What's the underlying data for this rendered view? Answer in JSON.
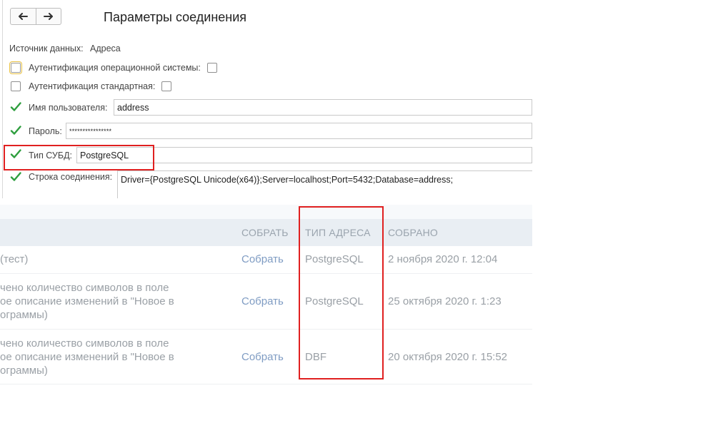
{
  "dialog": {
    "title": "Параметры соединения",
    "data_source": {
      "label": "Источник данных:",
      "value": "Адреса"
    },
    "os_auth": {
      "label": "Аутентификация операционной системы:",
      "enabled": false,
      "value": false
    },
    "std_auth": {
      "label": "Аутентификация стандартная:",
      "enabled": false,
      "value": false
    },
    "username": {
      "label": "Имя пользователя:",
      "enabled": true,
      "value": "address"
    },
    "password": {
      "label": "Пароль:",
      "enabled": true,
      "value": "****************"
    },
    "dbms_type": {
      "label": "Тип СУБД:",
      "enabled": true,
      "value": "PostgreSQL"
    },
    "connection_string": {
      "label": "Строка соединения:",
      "enabled": true,
      "value": "Driver={PostgreSQL Unicode(x64)};Server=localhost;Port=5432;Database=address;"
    },
    "icons": {
      "back": "arrow-left-icon",
      "forward": "arrow-right-icon",
      "check": "checkmark-icon"
    },
    "colors": {
      "check": "#2e9e3e",
      "highlight": "#e02020",
      "focus": "#e8c040"
    }
  },
  "table": {
    "columns": {
      "collect": "СОБРАТЬ",
      "address_type": "ТИП АДРЕСА",
      "collected": "СОБРАНО"
    },
    "rows": [
      {
        "desc_lines": [
          "(тест)"
        ],
        "action": "Собрать",
        "address_type": "PostgreSQL",
        "collected": "2 ноября 2020 г. 12:04"
      },
      {
        "desc_lines": [
          "чено количество символов в поле",
          "ое описание изменений в \"Новое в",
          "ограммы)"
        ],
        "action": "Собрать",
        "address_type": "PostgreSQL",
        "collected": "25 октября 2020 г. 1:23"
      },
      {
        "desc_lines": [
          "чено количество символов в поле",
          "ое описание изменений в \"Новое в",
          "ограммы)"
        ],
        "action": "Собрать",
        "address_type": "DBF",
        "collected": "20 октября 2020 г. 15:52"
      }
    ],
    "colors": {
      "header_bg": "#e9eef3",
      "link": "#7f9cc3",
      "text": "#9aa0a6"
    }
  }
}
